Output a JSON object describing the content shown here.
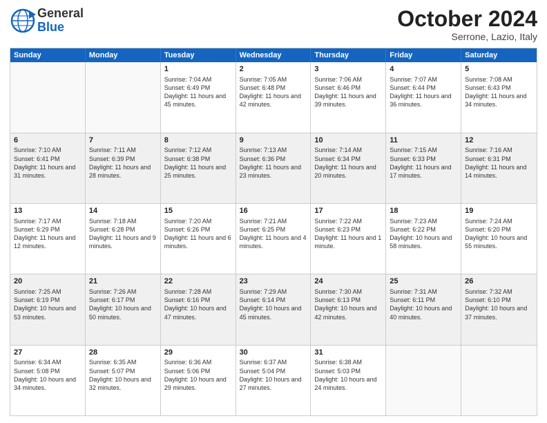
{
  "header": {
    "logo_general": "General",
    "logo_blue": "Blue",
    "month": "October 2024",
    "location": "Serrone, Lazio, Italy"
  },
  "weekdays": [
    "Sunday",
    "Monday",
    "Tuesday",
    "Wednesday",
    "Thursday",
    "Friday",
    "Saturday"
  ],
  "rows": [
    [
      {
        "day": "",
        "info": ""
      },
      {
        "day": "",
        "info": ""
      },
      {
        "day": "1",
        "info": "Sunrise: 7:04 AM\nSunset: 6:49 PM\nDaylight: 11 hours and 45 minutes."
      },
      {
        "day": "2",
        "info": "Sunrise: 7:05 AM\nSunset: 6:48 PM\nDaylight: 11 hours and 42 minutes."
      },
      {
        "day": "3",
        "info": "Sunrise: 7:06 AM\nSunset: 6:46 PM\nDaylight: 11 hours and 39 minutes."
      },
      {
        "day": "4",
        "info": "Sunrise: 7:07 AM\nSunset: 6:44 PM\nDaylight: 11 hours and 36 minutes."
      },
      {
        "day": "5",
        "info": "Sunrise: 7:08 AM\nSunset: 6:43 PM\nDaylight: 11 hours and 34 minutes."
      }
    ],
    [
      {
        "day": "6",
        "info": "Sunrise: 7:10 AM\nSunset: 6:41 PM\nDaylight: 11 hours and 31 minutes."
      },
      {
        "day": "7",
        "info": "Sunrise: 7:11 AM\nSunset: 6:39 PM\nDaylight: 11 hours and 28 minutes."
      },
      {
        "day": "8",
        "info": "Sunrise: 7:12 AM\nSunset: 6:38 PM\nDaylight: 11 hours and 25 minutes."
      },
      {
        "day": "9",
        "info": "Sunrise: 7:13 AM\nSunset: 6:36 PM\nDaylight: 11 hours and 23 minutes."
      },
      {
        "day": "10",
        "info": "Sunrise: 7:14 AM\nSunset: 6:34 PM\nDaylight: 11 hours and 20 minutes."
      },
      {
        "day": "11",
        "info": "Sunrise: 7:15 AM\nSunset: 6:33 PM\nDaylight: 11 hours and 17 minutes."
      },
      {
        "day": "12",
        "info": "Sunrise: 7:16 AM\nSunset: 6:31 PM\nDaylight: 11 hours and 14 minutes."
      }
    ],
    [
      {
        "day": "13",
        "info": "Sunrise: 7:17 AM\nSunset: 6:29 PM\nDaylight: 11 hours and 12 minutes."
      },
      {
        "day": "14",
        "info": "Sunrise: 7:18 AM\nSunset: 6:28 PM\nDaylight: 11 hours and 9 minutes."
      },
      {
        "day": "15",
        "info": "Sunrise: 7:20 AM\nSunset: 6:26 PM\nDaylight: 11 hours and 6 minutes."
      },
      {
        "day": "16",
        "info": "Sunrise: 7:21 AM\nSunset: 6:25 PM\nDaylight: 11 hours and 4 minutes."
      },
      {
        "day": "17",
        "info": "Sunrise: 7:22 AM\nSunset: 6:23 PM\nDaylight: 11 hours and 1 minute."
      },
      {
        "day": "18",
        "info": "Sunrise: 7:23 AM\nSunset: 6:22 PM\nDaylight: 10 hours and 58 minutes."
      },
      {
        "day": "19",
        "info": "Sunrise: 7:24 AM\nSunset: 6:20 PM\nDaylight: 10 hours and 55 minutes."
      }
    ],
    [
      {
        "day": "20",
        "info": "Sunrise: 7:25 AM\nSunset: 6:19 PM\nDaylight: 10 hours and 53 minutes."
      },
      {
        "day": "21",
        "info": "Sunrise: 7:26 AM\nSunset: 6:17 PM\nDaylight: 10 hours and 50 minutes."
      },
      {
        "day": "22",
        "info": "Sunrise: 7:28 AM\nSunset: 6:16 PM\nDaylight: 10 hours and 47 minutes."
      },
      {
        "day": "23",
        "info": "Sunrise: 7:29 AM\nSunset: 6:14 PM\nDaylight: 10 hours and 45 minutes."
      },
      {
        "day": "24",
        "info": "Sunrise: 7:30 AM\nSunset: 6:13 PM\nDaylight: 10 hours and 42 minutes."
      },
      {
        "day": "25",
        "info": "Sunrise: 7:31 AM\nSunset: 6:11 PM\nDaylight: 10 hours and 40 minutes."
      },
      {
        "day": "26",
        "info": "Sunrise: 7:32 AM\nSunset: 6:10 PM\nDaylight: 10 hours and 37 minutes."
      }
    ],
    [
      {
        "day": "27",
        "info": "Sunrise: 6:34 AM\nSunset: 5:08 PM\nDaylight: 10 hours and 34 minutes."
      },
      {
        "day": "28",
        "info": "Sunrise: 6:35 AM\nSunset: 5:07 PM\nDaylight: 10 hours and 32 minutes."
      },
      {
        "day": "29",
        "info": "Sunrise: 6:36 AM\nSunset: 5:06 PM\nDaylight: 10 hours and 29 minutes."
      },
      {
        "day": "30",
        "info": "Sunrise: 6:37 AM\nSunset: 5:04 PM\nDaylight: 10 hours and 27 minutes."
      },
      {
        "day": "31",
        "info": "Sunrise: 6:38 AM\nSunset: 5:03 PM\nDaylight: 10 hours and 24 minutes."
      },
      {
        "day": "",
        "info": ""
      },
      {
        "day": "",
        "info": ""
      }
    ]
  ]
}
